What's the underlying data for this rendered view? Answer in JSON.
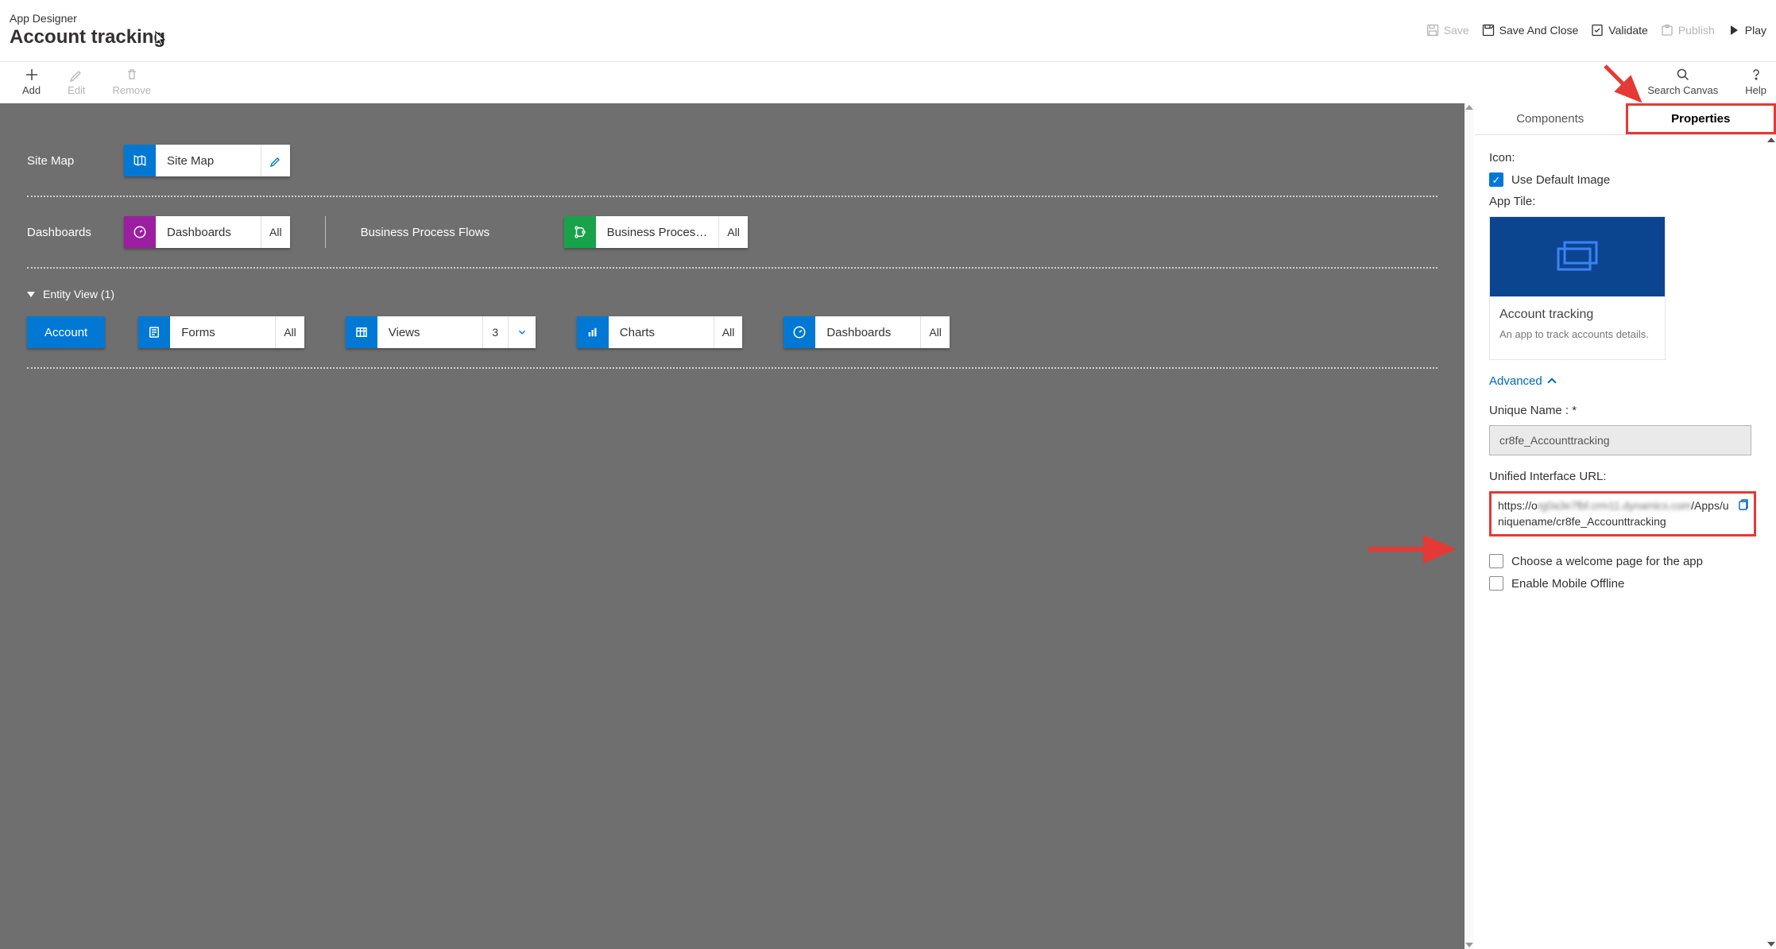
{
  "titlebar": {
    "app": "App Designer",
    "name": "Account tracking",
    "save": "Save",
    "save_close": "Save And Close",
    "validate": "Validate",
    "publish": "Publish",
    "play": "Play"
  },
  "toolbar": {
    "add": "Add",
    "edit": "Edit",
    "remove": "Remove",
    "search": "Search Canvas",
    "help": "Help"
  },
  "canvas": {
    "sitemap_label": "Site Map",
    "sitemap_tile": "Site Map",
    "dashboards_label": "Dashboards",
    "dashboards_tile": "Dashboards",
    "dashboards_suffix": "All",
    "bpf_label": "Business Process Flows",
    "bpf_tile": "Business Proces…",
    "bpf_suffix": "All",
    "entity_view_label": "Entity View (1)",
    "entity_name": "Account",
    "forms": {
      "label": "Forms",
      "suffix": "All"
    },
    "views": {
      "label": "Views",
      "suffix": "3"
    },
    "charts": {
      "label": "Charts",
      "suffix": "All"
    },
    "ent_dash": {
      "label": "Dashboards",
      "suffix": "All"
    }
  },
  "panel": {
    "tab_components": "Components",
    "tab_properties": "Properties",
    "icon_label": "Icon:",
    "use_default": "Use Default Image",
    "app_tile": "App Tile:",
    "card_title": "Account tracking",
    "card_desc": "An app to track accounts details.",
    "advanced": "Advanced",
    "unique_name_label": "Unique Name : *",
    "unique_name_value": "cr8fe_Accounttracking",
    "url_label": "Unified Interface URL:",
    "url_prefix": "https://o",
    "url_blurred": "rg0a3e7fbf.crm11.dynamics.com",
    "url_suffix_1": "/Apps/u",
    "url_line2": "niquename/cr8fe_Accounttracking",
    "welcome_chk": "Choose a welcome page for the app",
    "offline_chk": "Enable Mobile Offline"
  }
}
